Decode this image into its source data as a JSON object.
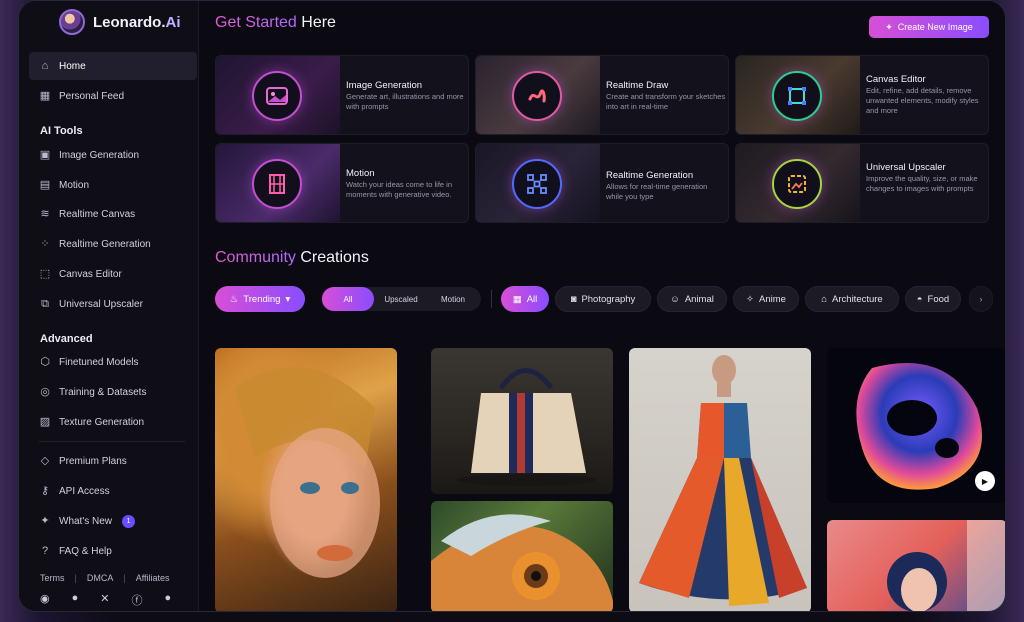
{
  "brand": {
    "name": "Leonardo.",
    "suffix": "Ai"
  },
  "sidebar": {
    "top": [
      {
        "label": "Home",
        "icon": "home-icon"
      },
      {
        "label": "Personal Feed",
        "icon": "grid-icon"
      }
    ],
    "ai_tools_title": "AI Tools",
    "ai_tools": [
      {
        "label": "Image Generation",
        "icon": "image-icon"
      },
      {
        "label": "Motion",
        "icon": "film-icon"
      },
      {
        "label": "Realtime Canvas",
        "icon": "brush-icon"
      },
      {
        "label": "Realtime Generation",
        "icon": "dots-grid-icon"
      },
      {
        "label": "Canvas Editor",
        "icon": "frame-icon"
      },
      {
        "label": "Universal Upscaler",
        "icon": "upscale-icon"
      }
    ],
    "advanced_title": "Advanced",
    "advanced": [
      {
        "label": "Finetuned Models",
        "icon": "cube-icon"
      },
      {
        "label": "Training & Datasets",
        "icon": "dataset-icon"
      },
      {
        "label": "Texture Generation",
        "icon": "texture-icon"
      }
    ],
    "bottom": [
      {
        "label": "Premium Plans",
        "icon": "diamond-icon"
      },
      {
        "label": "API Access",
        "icon": "key-icon"
      },
      {
        "label": "What's New",
        "icon": "megaphone-icon",
        "badge": "1"
      },
      {
        "label": "FAQ & Help",
        "icon": "help-icon"
      }
    ],
    "footer_links": [
      "Terms",
      "DMCA",
      "Affiliates"
    ],
    "social": [
      "discord-icon",
      "reddit-icon",
      "x-icon",
      "facebook-icon",
      "apple-icon"
    ]
  },
  "main": {
    "get_started_a": "Get Started",
    "get_started_b": " Here",
    "create_button": "Create New Image",
    "cards": [
      {
        "title": "Image Generation",
        "desc": "Generate art, illustrations and more with prompts",
        "icon": "image-icon"
      },
      {
        "title": "Realtime Draw",
        "desc": "Create and transform your sketches into art in real-time",
        "icon": "brush-icon"
      },
      {
        "title": "Canvas Editor",
        "desc": "Edit, refine, add details, remove unwanted elements, modify styles and more",
        "icon": "frame-icon"
      },
      {
        "title": "Motion",
        "desc": "Watch your ideas come to life in moments with generative video.",
        "icon": "film-icon"
      },
      {
        "title": "Realtime Generation",
        "desc": "Allows for real-time generation while you type",
        "icon": "dots-grid-icon"
      },
      {
        "title": "Universal Upscaler",
        "desc": "Improve the quality, size, or make changes to images with prompts",
        "icon": "upscale-icon"
      }
    ],
    "community_a": "Community",
    "community_b": " Creations",
    "filters": {
      "trending": "Trending",
      "segments": [
        "All",
        "Upscaled",
        "Motion"
      ],
      "categories": [
        "All",
        "Photography",
        "Animal",
        "Anime",
        "Architecture",
        "Food"
      ]
    }
  },
  "colors": {
    "accent_pink": "#d74fd6",
    "accent_purple": "#8a4dff",
    "bg": "#0b0a12"
  }
}
